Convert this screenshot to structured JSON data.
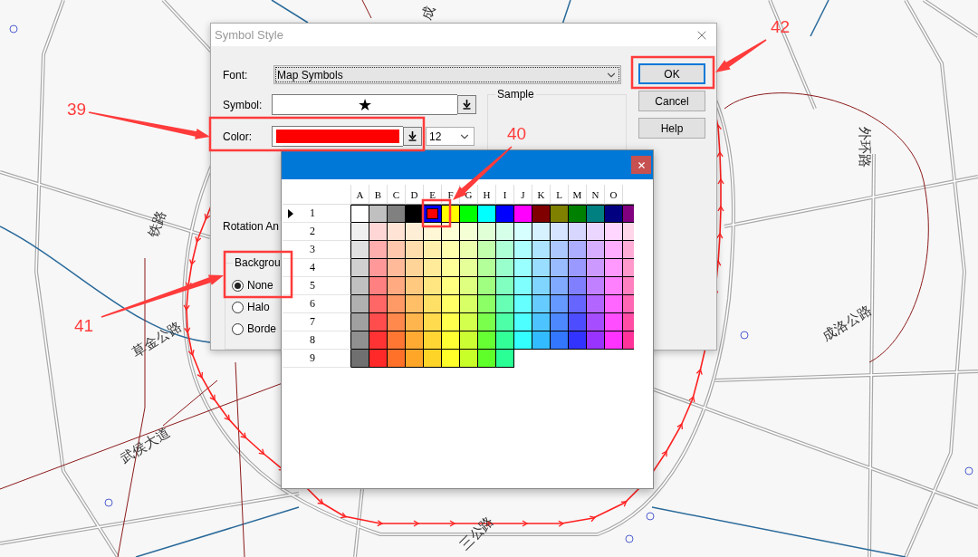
{
  "map": {
    "labels": [
      {
        "text": "成"
      },
      {
        "text": "铁路"
      },
      {
        "text": "草金公路"
      },
      {
        "text": "武侯大道"
      },
      {
        "text": "三公路"
      },
      {
        "text": "外环路"
      },
      {
        "text": "成洛公路"
      }
    ]
  },
  "dialog": {
    "title": "Symbol Style",
    "font": {
      "label": "Font:",
      "value": "Map Symbols"
    },
    "symbol": {
      "label": "Symbol:",
      "value": "★"
    },
    "color": {
      "label": "Color:",
      "color": "#ff0000"
    },
    "size": {
      "value": "12"
    },
    "sample": {
      "label": "Sample"
    },
    "rotation": {
      "label": "Rotation An"
    },
    "background": {
      "label": "Backgrou",
      "options": [
        {
          "label": "None",
          "selected": true
        },
        {
          "label": "Halo",
          "selected": false
        },
        {
          "label": "Borde",
          "selected": false
        }
      ]
    },
    "buttons": [
      {
        "label": "OK",
        "default": true
      },
      {
        "label": "Cancel",
        "default": false
      },
      {
        "label": "Help",
        "default": false
      }
    ]
  },
  "color_picker": {
    "columns": [
      "A",
      "B",
      "C",
      "D",
      "E",
      "F",
      "G",
      "H",
      "I",
      "J",
      "K",
      "L",
      "M",
      "N",
      "O"
    ],
    "rows": [
      {
        "label": "1",
        "selected": true,
        "cells": [
          {
            "color": "#ffffff",
            "selected": false
          },
          {
            "color": "#c0c0c0",
            "selected": false
          },
          {
            "color": "#808080",
            "selected": false
          },
          {
            "color": "#000000",
            "selected": false
          },
          {
            "color": "#ff0000",
            "selected": true
          },
          {
            "color": "#ffff00",
            "selected": false
          },
          {
            "color": "#00ff00",
            "selected": false
          },
          {
            "color": "#00ffff",
            "selected": false
          },
          {
            "color": "#0000ff",
            "selected": false
          },
          {
            "color": "#ff00ff",
            "selected": false
          },
          {
            "color": "#800000",
            "selected": false
          },
          {
            "color": "#808000",
            "selected": false
          },
          {
            "color": "#008000",
            "selected": false
          },
          {
            "color": "#008080",
            "selected": false
          },
          {
            "color": "#000080",
            "selected": false
          },
          {
            "color": "#800080",
            "selected": false
          }
        ]
      },
      {
        "label": "2",
        "selected": false,
        "cells": [
          {
            "color": "#f0f0f0",
            "selected": false
          },
          {
            "color": "#ffd6d6",
            "selected": false
          },
          {
            "color": "#ffe4d6",
            "selected": false
          },
          {
            "color": "#ffeed6",
            "selected": false
          },
          {
            "color": "#fff7d6",
            "selected": false
          },
          {
            "color": "#ffffd6",
            "selected": false
          },
          {
            "color": "#f5ffd6",
            "selected": false
          },
          {
            "color": "#e0ffd6",
            "selected": false
          },
          {
            "color": "#d6ffea",
            "selected": false
          },
          {
            "color": "#d6ffff",
            "selected": false
          },
          {
            "color": "#d6f1ff",
            "selected": false
          },
          {
            "color": "#d6e4ff",
            "selected": false
          },
          {
            "color": "#d6d6ff",
            "selected": false
          },
          {
            "color": "#ead6ff",
            "selected": false
          },
          {
            "color": "#ffd6ff",
            "selected": false
          },
          {
            "color": "#ffd6ea",
            "selected": false
          }
        ]
      },
      {
        "label": "3",
        "selected": false,
        "cells": [
          {
            "color": "#e0e0e0",
            "selected": false
          },
          {
            "color": "#ffadad",
            "selected": false
          },
          {
            "color": "#ffc8ad",
            "selected": false
          },
          {
            "color": "#ffddad",
            "selected": false
          },
          {
            "color": "#ffefad",
            "selected": false
          },
          {
            "color": "#ffffad",
            "selected": false
          },
          {
            "color": "#ebffad",
            "selected": false
          },
          {
            "color": "#c2ffad",
            "selected": false
          },
          {
            "color": "#adffd6",
            "selected": false
          },
          {
            "color": "#adffff",
            "selected": false
          },
          {
            "color": "#ade4ff",
            "selected": false
          },
          {
            "color": "#adc8ff",
            "selected": false
          },
          {
            "color": "#adadff",
            "selected": false
          },
          {
            "color": "#d6adff",
            "selected": false
          },
          {
            "color": "#ffadff",
            "selected": false
          },
          {
            "color": "#ffadd6",
            "selected": false
          }
        ]
      },
      {
        "label": "4",
        "selected": false,
        "cells": [
          {
            "color": "#d0d0d0",
            "selected": false
          },
          {
            "color": "#ff9999",
            "selected": false
          },
          {
            "color": "#ffbb99",
            "selected": false
          },
          {
            "color": "#ffd499",
            "selected": false
          },
          {
            "color": "#ffeb99",
            "selected": false
          },
          {
            "color": "#ffff99",
            "selected": false
          },
          {
            "color": "#e6ff99",
            "selected": false
          },
          {
            "color": "#b3ff99",
            "selected": false
          },
          {
            "color": "#99ffcc",
            "selected": false
          },
          {
            "color": "#99ffff",
            "selected": false
          },
          {
            "color": "#99ddff",
            "selected": false
          },
          {
            "color": "#99bbff",
            "selected": false
          },
          {
            "color": "#9999ff",
            "selected": false
          },
          {
            "color": "#cc99ff",
            "selected": false
          },
          {
            "color": "#ff99ff",
            "selected": false
          },
          {
            "color": "#ff99cc",
            "selected": false
          }
        ]
      },
      {
        "label": "5",
        "selected": false,
        "cells": [
          {
            "color": "#c0c0c0",
            "selected": false
          },
          {
            "color": "#ff8080",
            "selected": false
          },
          {
            "color": "#ffaa80",
            "selected": false
          },
          {
            "color": "#ffca80",
            "selected": false
          },
          {
            "color": "#ffe680",
            "selected": false
          },
          {
            "color": "#ffff80",
            "selected": false
          },
          {
            "color": "#dfff80",
            "selected": false
          },
          {
            "color": "#a0ff80",
            "selected": false
          },
          {
            "color": "#80ffc0",
            "selected": false
          },
          {
            "color": "#80ffff",
            "selected": false
          },
          {
            "color": "#80d5ff",
            "selected": false
          },
          {
            "color": "#80aaff",
            "selected": false
          },
          {
            "color": "#8080ff",
            "selected": false
          },
          {
            "color": "#c080ff",
            "selected": false
          },
          {
            "color": "#ff80ff",
            "selected": false
          },
          {
            "color": "#ff80c0",
            "selected": false
          }
        ]
      },
      {
        "label": "6",
        "selected": false,
        "cells": [
          {
            "color": "#b0b0b0",
            "selected": false
          },
          {
            "color": "#ff6666",
            "selected": false
          },
          {
            "color": "#ff9966",
            "selected": false
          },
          {
            "color": "#ffbf66",
            "selected": false
          },
          {
            "color": "#ffe066",
            "selected": false
          },
          {
            "color": "#ffff66",
            "selected": false
          },
          {
            "color": "#d9ff66",
            "selected": false
          },
          {
            "color": "#8cff66",
            "selected": false
          },
          {
            "color": "#66ffb3",
            "selected": false
          },
          {
            "color": "#66ffff",
            "selected": false
          },
          {
            "color": "#66ccff",
            "selected": false
          },
          {
            "color": "#6699ff",
            "selected": false
          },
          {
            "color": "#6666ff",
            "selected": false
          },
          {
            "color": "#b366ff",
            "selected": false
          },
          {
            "color": "#ff66ff",
            "selected": false
          },
          {
            "color": "#ff66b3",
            "selected": false
          }
        ]
      },
      {
        "label": "7",
        "selected": false,
        "cells": [
          {
            "color": "#a0a0a0",
            "selected": false
          },
          {
            "color": "#ff4d4d",
            "selected": false
          },
          {
            "color": "#ff884d",
            "selected": false
          },
          {
            "color": "#ffb54d",
            "selected": false
          },
          {
            "color": "#ffdb4d",
            "selected": false
          },
          {
            "color": "#ffff4d",
            "selected": false
          },
          {
            "color": "#d3ff4d",
            "selected": false
          },
          {
            "color": "#7aff4d",
            "selected": false
          },
          {
            "color": "#4dffa6",
            "selected": false
          },
          {
            "color": "#4dffff",
            "selected": false
          },
          {
            "color": "#4dc4ff",
            "selected": false
          },
          {
            "color": "#4d88ff",
            "selected": false
          },
          {
            "color": "#4d4dff",
            "selected": false
          },
          {
            "color": "#a64dff",
            "selected": false
          },
          {
            "color": "#ff4dff",
            "selected": false
          },
          {
            "color": "#ff4da6",
            "selected": false
          }
        ]
      },
      {
        "label": "8",
        "selected": false,
        "cells": [
          {
            "color": "#909090",
            "selected": false
          },
          {
            "color": "#ff3333",
            "selected": false
          },
          {
            "color": "#ff7733",
            "selected": false
          },
          {
            "color": "#ffaa33",
            "selected": false
          },
          {
            "color": "#ffd633",
            "selected": false
          },
          {
            "color": "#ffff33",
            "selected": false
          },
          {
            "color": "#ccff33",
            "selected": false
          },
          {
            "color": "#66ff33",
            "selected": false
          },
          {
            "color": "#33ff99",
            "selected": false
          },
          {
            "color": "#33ffff",
            "selected": false
          },
          {
            "color": "#33bbff",
            "selected": false
          },
          {
            "color": "#3377ff",
            "selected": false
          },
          {
            "color": "#3333ff",
            "selected": false
          },
          {
            "color": "#9933ff",
            "selected": false
          },
          {
            "color": "#ff33ff",
            "selected": false
          },
          {
            "color": "#ff3399",
            "selected": false
          }
        ]
      },
      {
        "label": "9",
        "selected": false,
        "cells": [
          {
            "color": "#707070",
            "selected": false
          },
          {
            "color": "#ff2929",
            "selected": false
          },
          {
            "color": "#ff7029",
            "selected": false
          },
          {
            "color": "#ffa629",
            "selected": false
          },
          {
            "color": "#ffd429",
            "selected": false
          },
          {
            "color": "#ffff29",
            "selected": false
          },
          {
            "color": "#c9ff29",
            "selected": false
          },
          {
            "color": "#5fff29",
            "selected": false
          },
          {
            "color": "#29ff94",
            "selected": false
          }
        ]
      }
    ]
  },
  "callouts": [
    {
      "label": "39"
    },
    {
      "label": "40"
    },
    {
      "label": "41"
    },
    {
      "label": "42"
    }
  ]
}
